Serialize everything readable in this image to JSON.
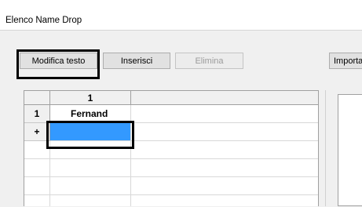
{
  "window": {
    "title": "Elenco Name Drop"
  },
  "toolbar": {
    "edit_text_label": "Modifica testo",
    "insert_label": "Inserisci",
    "delete_label": "Elimina",
    "import_label": "Importa"
  },
  "grid": {
    "column_header": "1",
    "rows": [
      {
        "header": "1",
        "value": "Fernand"
      },
      {
        "header": "+",
        "value": ""
      }
    ]
  }
}
